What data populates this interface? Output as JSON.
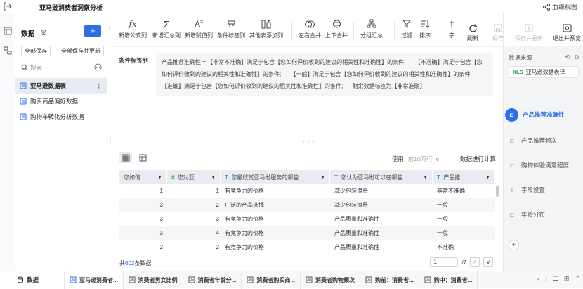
{
  "app": {
    "title": "亚马逊消费者洞察分析",
    "lineage_label": "血缘视图"
  },
  "sidebar": {
    "header": "数据",
    "add_label": "+",
    "save_all": "全部保存",
    "save_all_update": "全部保存并更新",
    "search_placeholder": "搜索",
    "items": [
      {
        "label": "亚马逊数据表",
        "selected": true
      },
      {
        "label": "购买商品偏好数据",
        "selected": false
      },
      {
        "label": "购物车转化分析数据",
        "selected": false
      }
    ]
  },
  "toolbar": {
    "buttons": [
      {
        "label": "新增公式列",
        "icon": "fx-icon"
      },
      {
        "label": "新增汇总列",
        "icon": "sigma-icon"
      },
      {
        "label": "新增赋值列",
        "icon": "assign-icon"
      },
      {
        "label": "条件标签列",
        "icon": "tag-icon"
      },
      {
        "label": "其他表添加列",
        "icon": "add-column-icon"
      },
      {
        "label": "左右合并",
        "icon": "merge-lr-icon"
      },
      {
        "label": "上下合并",
        "icon": "merge-ud-icon"
      },
      {
        "label": "分组汇总",
        "icon": "group-icon"
      },
      {
        "label": "过滤",
        "icon": "filter-icon"
      },
      {
        "label": "排序",
        "icon": "sort-icon"
      },
      {
        "label": "字",
        "icon": "field-icon"
      }
    ]
  },
  "right_actions": [
    {
      "label": "刷新",
      "icon": "refresh-icon",
      "enabled": true
    },
    {
      "label": "保存",
      "icon": "save-icon",
      "enabled": false
    },
    {
      "label": "保存并更新",
      "icon": "save-update-icon",
      "enabled": false
    },
    {
      "label": "退出并预览",
      "icon": "exit-preview-icon",
      "enabled": true
    }
  ],
  "flow": {
    "caption": "数据来源",
    "source": {
      "badge": "XLS",
      "label": "亚马逊数据表译"
    },
    "steps": [
      {
        "label": "产品推荐准确性",
        "active": true
      },
      {
        "label": "产品推荐频次",
        "active": false
      },
      {
        "label": "购物体验满意程度",
        "active": false
      },
      {
        "label": "字段设置",
        "active": false
      },
      {
        "label": "年龄分布",
        "active": false
      }
    ],
    "add_label": "+"
  },
  "condition": {
    "label": "条件标签列",
    "expression": "产品推荐准确性 = 【非常不准确】满足于包含【您如何评价收到的建议的相关性和准确性】的条件;      【不准确】满足于包含【您如何评价收到的建议的相关性和准确性】的条件;      【一般】满足于包含【您如何评价收到的建议的相关性和准确性】的条件;      【准确】满足于包含【您如何评价收到的建议的相关性和准确性】的条件;      剩余数据标签为【非常准确】"
  },
  "data_view": {
    "use_label": "使用",
    "row_limit": "前10万行",
    "calc_label": "数据进行计算",
    "columns": [
      {
        "label": "您如何...",
        "type": "",
        "type_icon": ""
      },
      {
        "label": "您对亚...",
        "type": "number",
        "type_icon": "#"
      },
      {
        "label": "您最欣赏亚马逊服务的哪些...",
        "type": "text",
        "type_icon": "T"
      },
      {
        "label": "您认为亚马逊可以在哪些...",
        "type": "text",
        "type_icon": "T"
      },
      {
        "label": "产品推...",
        "type": "text",
        "type_icon": "T"
      }
    ],
    "rows": [
      [
        "1",
        "1",
        "有竞争力的价格",
        "减少包装浪费",
        "非常不准确"
      ],
      [
        "3",
        "2",
        "广泛的产品选择",
        "减少包装浪费",
        "一般"
      ],
      [
        "3",
        "3",
        "有竞争力的价格",
        "产品质量和准确性",
        "一般"
      ],
      [
        "3",
        "4",
        "有竞争力的价格",
        "产品质量和准确性",
        "一般"
      ],
      [
        "2",
        "2",
        "有竞争力的价格",
        "产品质量和准确性",
        "不准确"
      ]
    ],
    "total_prefix": "共",
    "total_count": "602",
    "total_suffix": "条数据",
    "page_current": "1",
    "page_total": "/7"
  },
  "bottom_tabs": [
    {
      "label": "数据",
      "active": false
    },
    {
      "label": "亚马逊消费者...",
      "active": true
    },
    {
      "label": "消费者男女比例",
      "active": false
    },
    {
      "label": "消费者年龄分...",
      "active": false
    },
    {
      "label": "消费者购买商...",
      "active": false
    },
    {
      "label": "消费者购物频次",
      "active": false
    },
    {
      "label": "购前：消费者...",
      "active": false
    },
    {
      "label": "购中：消费者...",
      "active": false
    }
  ]
}
